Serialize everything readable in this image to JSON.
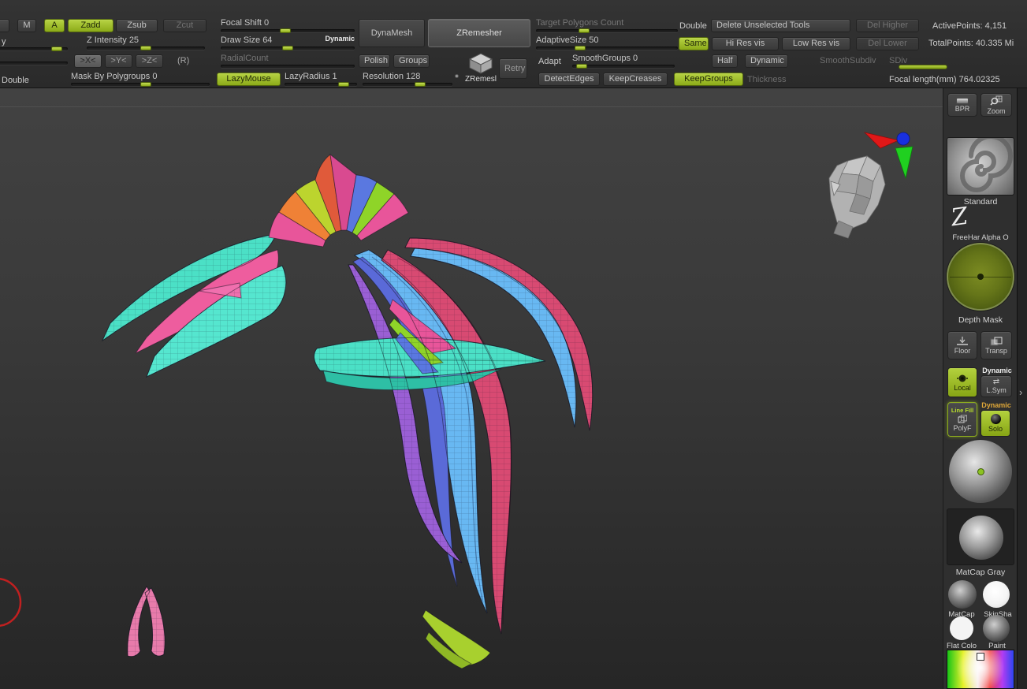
{
  "toolbar": {
    "draw": {
      "m": "M",
      "a": "A",
      "zadd": "Zadd",
      "zsub": "Zsub",
      "zcut": "Zcut",
      "focal_shift_label": "Focal Shift",
      "focal_shift_value": "0",
      "z_intensity_label": "Z Intensity",
      "z_intensity_value": "25",
      "draw_size_label": "Draw Size",
      "draw_size_value": "64",
      "dynamic_tag": "Dynamic",
      "y_partial": "y",
      "mirror_x": ">X<",
      "mirror_y": ">Y<",
      "mirror_z": ">Z<",
      "radial_r": "(R)",
      "radial_count_label": "RadialCount",
      "double_partial": "Double",
      "mask_by_polygroups_label": "Mask By Polygroups",
      "mask_by_polygroups_value": "0",
      "lazy_mouse": "LazyMouse",
      "lazy_radius_label": "LazyRadius",
      "lazy_radius_value": "1"
    },
    "geometry": {
      "dynamesh": "DynaMesh",
      "zremesher": "ZRemesher",
      "polish": "Polish",
      "groups": "Groups",
      "resolution_label": "Resolution",
      "resolution_value": "128",
      "zremesh_tool_label": "ZRemesl",
      "retry": "Retry",
      "target_polygons_label": "Target Polygons Count",
      "adaptive_size_label": "AdaptiveSize",
      "adaptive_size_value": "50",
      "adapt_label": "Adapt",
      "smooth_groups_label": "SmoothGroups",
      "smooth_groups_value": "0",
      "detect_edges": "DetectEdges",
      "keep_creases": "KeepCreases",
      "keep_groups": "KeepGroups",
      "thickness": "Thickness"
    },
    "subtool": {
      "double": "Double",
      "delete_unselected": "Delete Unselected Tools",
      "del_higher": "Del Higher",
      "same": "Same",
      "hi_res_vis": "Hi Res vis",
      "low_res_vis": "Low Res vis",
      "del_lower": "Del Lower",
      "half": "Half",
      "dynamic": "Dynamic",
      "smooth_subdiv": "SmoothSubdiv",
      "sdiv": "SDiv"
    },
    "stats": {
      "active_points": "ActivePoints: 4,151",
      "total_points": "TotalPoints: 40.335 Mi",
      "focal_length_label": "Focal length(mm)",
      "focal_length_value": "764.02325"
    }
  },
  "sidebar": {
    "bpr": "BPR",
    "zoom": "Zoom",
    "brush_label": "Standard",
    "stroke_alpha_label": "FreeHar Alpha O",
    "texture_label": "Depth Mask",
    "floor": "Floor",
    "transp": "Transp",
    "local": "Local",
    "dynamic_persp": "Dynamic",
    "lsym": "L.Sym",
    "line_fill": "Line Fill",
    "polyf": "PolyF",
    "dynamic_solo": "Dynamic",
    "solo": "Solo",
    "matcap_gray": "MatCap Gray",
    "matcap": "MatCap",
    "skin_shade": "SkinSha",
    "flat_color": "Flat Colo",
    "paint": "Paint"
  },
  "colors": {
    "accent_green": "#9ab622",
    "canvas_bg_top": "#414141",
    "canvas_bg_bottom": "#262626"
  }
}
